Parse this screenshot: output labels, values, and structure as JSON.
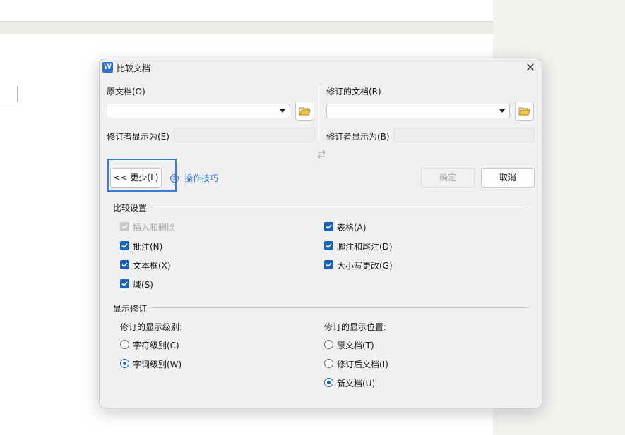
{
  "dialog": {
    "app_icon_letter": "W",
    "title": "比较文档",
    "close_glyph": "✕"
  },
  "original": {
    "label": "原文档(O)",
    "value": "",
    "author_label": "修订者显示为(E)",
    "author_value": ""
  },
  "revised": {
    "label": "修订的文档(R)",
    "value": "",
    "author_label": "修订者显示为(B)",
    "author_value": ""
  },
  "buttons": {
    "less": "<< 更少(L)",
    "tips_icon": "⊕",
    "tips": "操作技巧",
    "ok": "确定",
    "cancel": "取消"
  },
  "compare_settings": {
    "title": "比较设置",
    "left": [
      {
        "label": "插入和删除",
        "checked": true,
        "disabled": true
      },
      {
        "label": "批注(N)",
        "checked": true,
        "disabled": false
      },
      {
        "label": "文本框(X)",
        "checked": true,
        "disabled": false
      },
      {
        "label": "域(S)",
        "checked": true,
        "disabled": false
      }
    ],
    "right": [
      {
        "label": "表格(A)",
        "checked": true
      },
      {
        "label": "脚注和尾注(D)",
        "checked": true
      },
      {
        "label": "大小写更改(G)",
        "checked": true
      }
    ]
  },
  "show_revisions": {
    "title": "显示修订",
    "level_label": "修订的显示级别:",
    "level_options": [
      {
        "label": "字符级别(C)",
        "selected": false
      },
      {
        "label": "字词级别(W)",
        "selected": true
      }
    ],
    "position_label": "修订的显示位置:",
    "position_options": [
      {
        "label": "原文档(T)",
        "selected": false
      },
      {
        "label": "修订后文档(I)",
        "selected": false
      },
      {
        "label": "新文档(U)",
        "selected": true
      }
    ]
  },
  "colors": {
    "accent": "#1c62b9",
    "link": "#2e75d4",
    "highlight_border": "#3b7ddd"
  },
  "icons": [
    "word-app-icon",
    "close-icon",
    "folder-open-icon",
    "swap-icon",
    "tips-icon",
    "checkbox-check-icon"
  ]
}
